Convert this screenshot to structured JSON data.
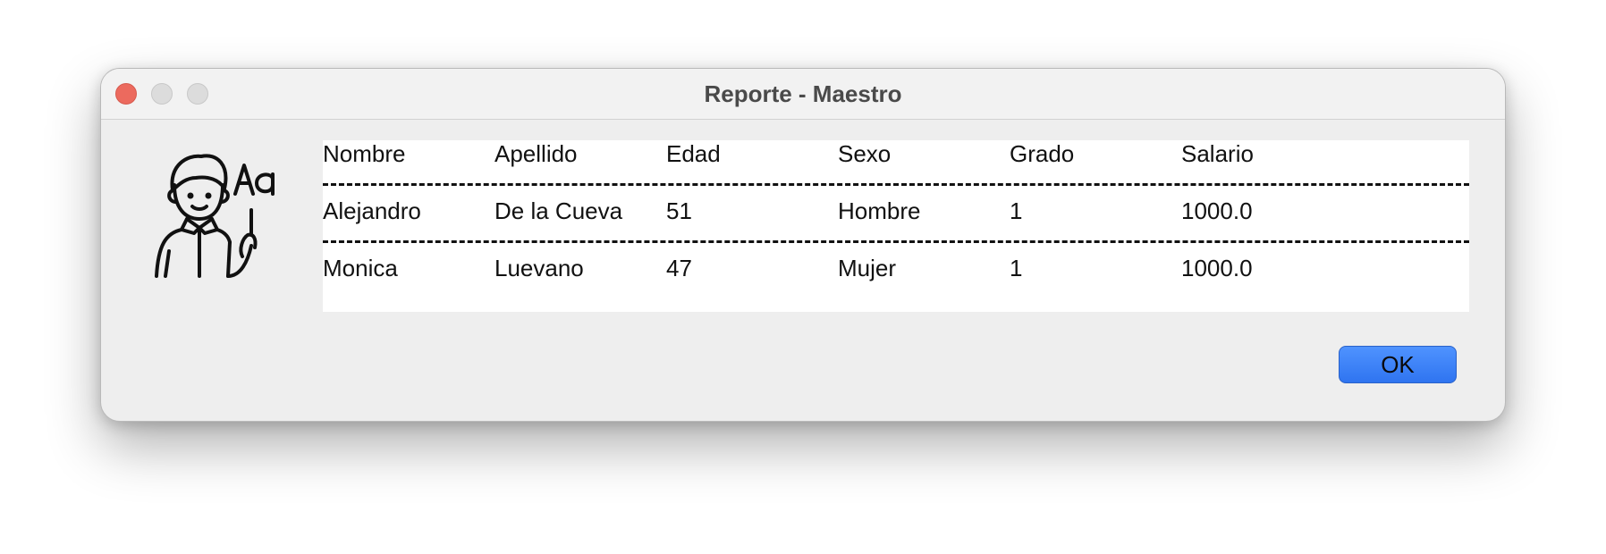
{
  "window": {
    "title": "Reporte - Maestro"
  },
  "icons": {
    "avatar": "teacher-icon",
    "close": "close-window-icon",
    "minimize": "minimize-window-icon",
    "maximize": "maximize-window-icon"
  },
  "report": {
    "headers": [
      "Nombre",
      "Apellido",
      "Edad",
      "Sexo",
      "Grado",
      "Salario"
    ],
    "rows": [
      [
        "Alejandro",
        "De la Cueva",
        "51",
        "Hombre",
        "1",
        "1000.0"
      ],
      [
        "Monica",
        "Luevano",
        "47",
        "Mujer",
        "1",
        "1000.0"
      ]
    ]
  },
  "buttons": {
    "ok_label": "OK"
  },
  "colors": {
    "accent": "#3b82f6",
    "close_light": "#ec6a5e",
    "inactive_light": "#dcdcdc",
    "dialog_bg": "#eeeeee"
  }
}
